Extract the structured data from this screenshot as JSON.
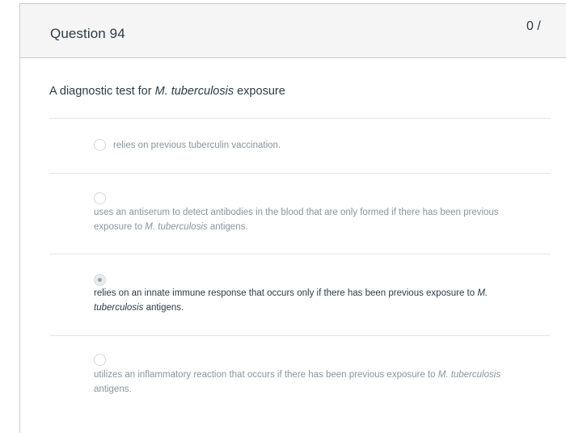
{
  "question": {
    "title": "Question 94",
    "points": "0 /",
    "prompt_prefix": "A diagnostic test for ",
    "prompt_italic": "M. tuberculosis",
    "prompt_suffix": " exposure"
  },
  "answers": [
    {
      "selected": false,
      "line1": "relies on previous tuberculin vaccination.",
      "line2_prefix": "",
      "line2_italic": "",
      "line2_suffix": ""
    },
    {
      "selected": false,
      "line1": "uses an antiserum to detect antibodies in the blood that are only formed if there has been previous",
      "line2_prefix": "exposure to ",
      "line2_italic": "M. tuberculosis",
      "line2_suffix": " antigens."
    },
    {
      "selected": true,
      "line1_prefix": "relies on an innate immune response that occurs only if there has been previous exposure to ",
      "line1_italic": "M.",
      "line2_italic": "tuberculosis",
      "line2_suffix": " antigens."
    },
    {
      "selected": false,
      "line1_prefix": "utilizes an inflammatory reaction that occurs if there has been previous exposure to ",
      "line1_italic": "M. tuberculosis",
      "line2": "antigens."
    }
  ],
  "colors": {
    "flag": "#d9201f",
    "header_bg": "#f5f5f5",
    "text_primary": "#2d3b45",
    "text_muted": "#8a9499"
  }
}
